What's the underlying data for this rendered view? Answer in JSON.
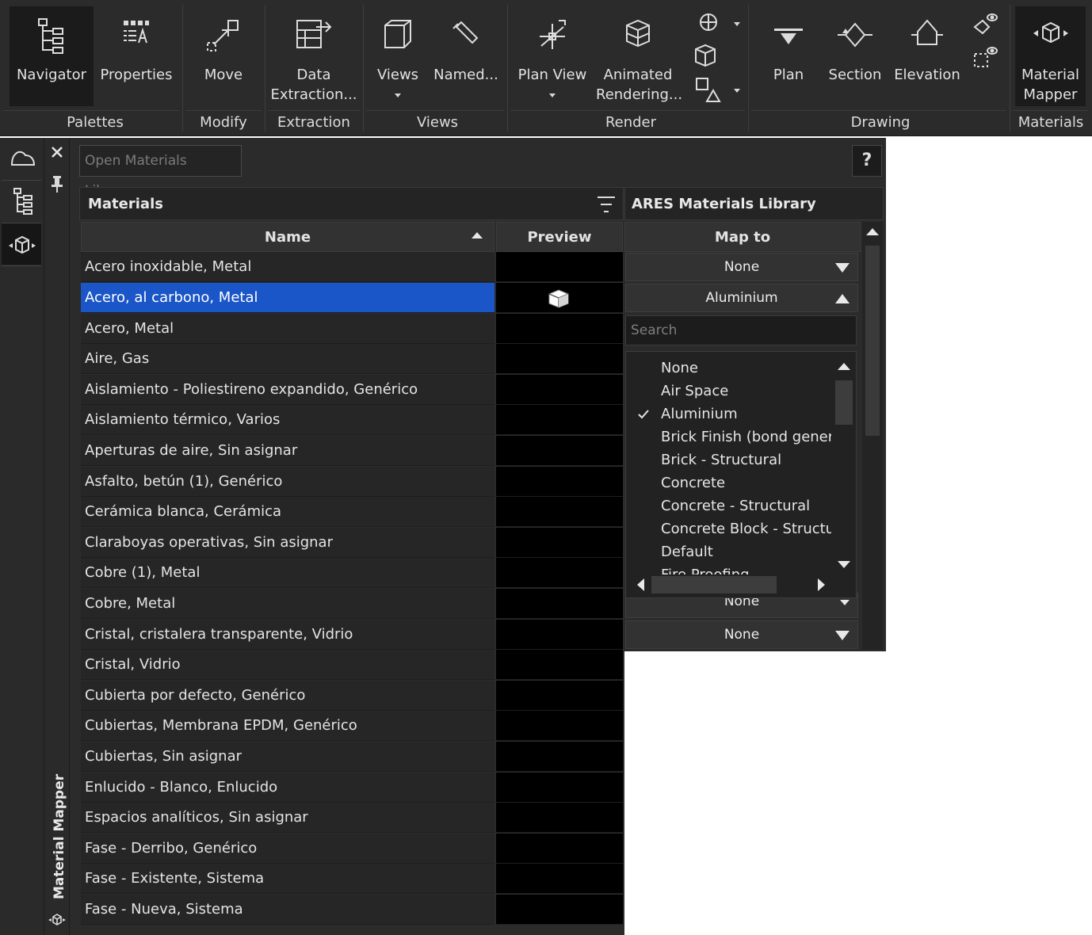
{
  "ribbon": {
    "buttons": {
      "navigator": "Navigator",
      "properties": "Properties",
      "move": "Move",
      "data_extraction_1": "Data",
      "data_extraction_2": "Extraction...",
      "views": "Views",
      "named": "Named...",
      "plan_view": "Plan View",
      "animated_1": "Animated",
      "animated_2": "Rendering...",
      "plan": "Plan",
      "section": "Section",
      "elevation": "Elevation",
      "material_mapper_1": "Material",
      "material_mapper_2": "Mapper"
    },
    "groups": {
      "palettes": "Palettes",
      "modify": "Modify",
      "extraction": "Extraction",
      "views": "Views",
      "render": "Render",
      "drawing": "Drawing",
      "materials": "Materials"
    }
  },
  "sidebar": {
    "title": "Material Mapper",
    "close_glyph": "✕"
  },
  "panel": {
    "open_library": "Open Materials Library...",
    "help": "?",
    "materials_header": "Materials",
    "library_header": "ARES Materials Library",
    "col_name": "Name",
    "col_preview": "Preview",
    "col_map_to": "Map to",
    "search_placeholder": "Search"
  },
  "materials": [
    {
      "name": "Acero inoxidable, Metal"
    },
    {
      "name": "Acero, al carbono, Metal"
    },
    {
      "name": "Acero, Metal"
    },
    {
      "name": "Aire, Gas"
    },
    {
      "name": "Aislamiento - Poliestireno expandido, Genérico"
    },
    {
      "name": "Aislamiento térmico, Varios"
    },
    {
      "name": "Aperturas de aire, Sin asignar"
    },
    {
      "name": "Asfalto,  betún (1), Genérico"
    },
    {
      "name": "Cerámica blanca, Cerámica"
    },
    {
      "name": "Claraboyas operativas, Sin asignar"
    },
    {
      "name": "Cobre (1), Metal"
    },
    {
      "name": "Cobre, Metal"
    },
    {
      "name": "Cristal, cristalera transparente, Vidrio"
    },
    {
      "name": "Cristal, Vidrio"
    },
    {
      "name": "Cubierta por defecto, Genérico"
    },
    {
      "name": "Cubiertas, Membrana EPDM, Genérico"
    },
    {
      "name": "Cubiertas, Sin asignar"
    },
    {
      "name": "Enlucido - Blanco, Enlucido"
    },
    {
      "name": "Espacios analíticos, Sin asignar"
    },
    {
      "name": "Fase - Derribo, Genérico"
    },
    {
      "name": "Fase - Existente, Sistema"
    },
    {
      "name": "Fase - Nueva, Sistema"
    }
  ],
  "selected_index": 1,
  "map_to": {
    "row0": "None",
    "row1": "Aluminium",
    "partial": "None",
    "last": "None"
  },
  "dropdown_options": [
    "None",
    "Air Space",
    "Aluminium",
    "Brick Finish (bond generic",
    "Brick - Structural",
    "Concrete",
    "Concrete - Structural",
    "Concrete Block - Structural",
    "Default",
    "Fire Proofing"
  ],
  "dropdown_checked": "Aluminium",
  "colors": {
    "selection": "#1a56c7",
    "background": "#2b2b2b",
    "preview": "#000000"
  }
}
